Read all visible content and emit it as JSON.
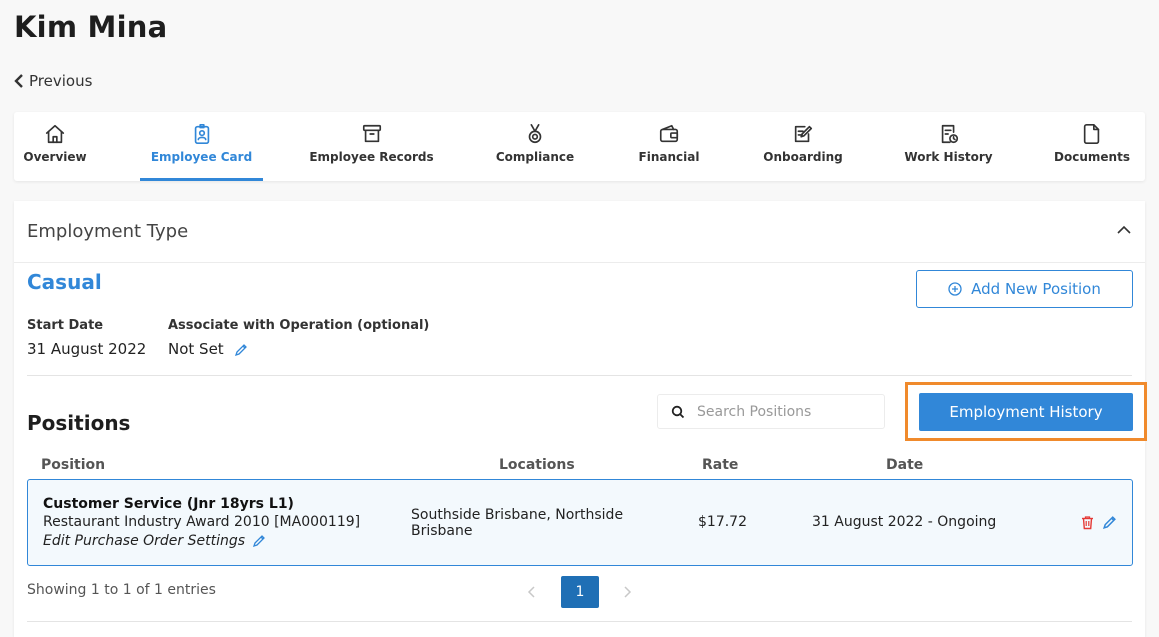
{
  "header": {
    "title": "Kim Mina",
    "previous_label": "Previous"
  },
  "tabs": [
    {
      "label": "Overview",
      "icon": "home-icon"
    },
    {
      "label": "Employee Card",
      "icon": "id-badge-icon",
      "active": true
    },
    {
      "label": "Employee Records",
      "icon": "archive-box-icon"
    },
    {
      "label": "Compliance",
      "icon": "medal-icon"
    },
    {
      "label": "Financial",
      "icon": "wallet-icon"
    },
    {
      "label": "Onboarding",
      "icon": "edit-document-icon"
    },
    {
      "label": "Work History",
      "icon": "history-document-icon"
    },
    {
      "label": "Documents",
      "icon": "document-icon"
    }
  ],
  "employment": {
    "section_title": "Employment Type",
    "type": "Casual",
    "add_position_label": "Add New Position",
    "start_date_label": "Start Date",
    "start_date": "31 August 2022",
    "operation_label": "Associate with Operation (optional)",
    "operation_value": "Not Set"
  },
  "positions": {
    "title": "Positions",
    "search_placeholder": "Search Positions",
    "history_button": "Employment History",
    "columns": [
      "Position",
      "Locations",
      "Rate",
      "Date"
    ],
    "rows": [
      {
        "name": "Customer Service (Jnr 18yrs L1)",
        "award": "Restaurant Industry Award 2010 [MA000119]",
        "edit_link": "Edit Purchase Order Settings",
        "locations": "Southside Brisbane, Northside Brisbane",
        "rate": "$17.72",
        "date": "31 August 2022 - Ongoing"
      }
    ],
    "showing_text": "Showing 1 to 1 of 1 entries",
    "current_page": "1"
  },
  "colors": {
    "accent": "#3187d8",
    "highlight": "#f08a2c",
    "delete": "#e53935"
  }
}
